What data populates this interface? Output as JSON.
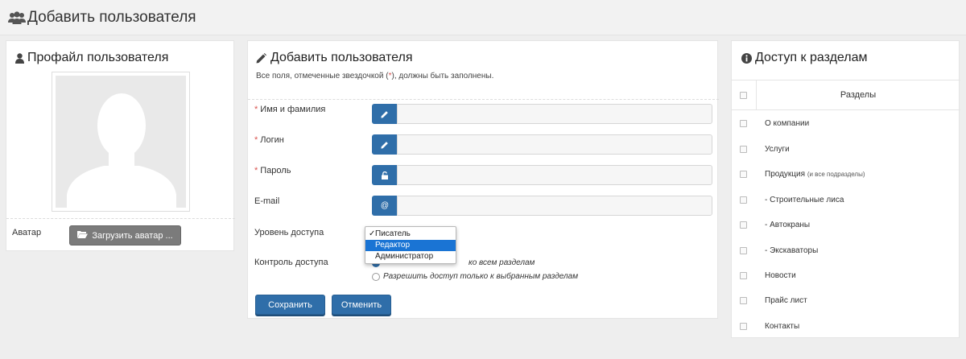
{
  "page": {
    "title": "Добавить пользователя",
    "icon": "users-icon"
  },
  "profile": {
    "title": "Профайл пользователя",
    "icon": "user-icon",
    "avatar_label": "Аватар",
    "upload_button": "Загрузить аватар ...",
    "upload_icon": "folder-open-icon"
  },
  "add_user": {
    "title": "Добавить пользователя",
    "icon": "pencil-icon",
    "note_before": "Все поля, отмеченные звездочкой (",
    "note_star": "*",
    "note_after": "), должны быть заполнены.",
    "fields": [
      {
        "label": "Имя и фамилия",
        "required": true,
        "icon": "pencil-icon",
        "value": ""
      },
      {
        "label": "Логин",
        "required": true,
        "icon": "pencil-icon",
        "value": ""
      },
      {
        "label": "Пароль",
        "required": true,
        "icon": "lock-icon",
        "value": ""
      },
      {
        "label": "E-mail",
        "required": false,
        "icon": "at-icon",
        "value": ""
      }
    ],
    "access_level": {
      "label": "Уровень доступа",
      "options": [
        "Писатель",
        "Редактор",
        "Администратор"
      ],
      "checked": "Писатель",
      "highlighted": "Редактор"
    },
    "access_control": {
      "label": "Контроль доступа",
      "options": [
        {
          "label": "Разрешить доступ ко всем разделам",
          "visible_text": "ко всем разделам",
          "selected": true
        },
        {
          "label": "Разрешить доступ только к выбранным разделам",
          "selected": false
        }
      ]
    },
    "save_button": "Сохранить",
    "cancel_button": "Отменить"
  },
  "access": {
    "title": "Доступ к разделам",
    "icon": "info-circle-icon",
    "column_header": "Разделы",
    "sections": [
      {
        "label": "О компании",
        "suffix": ""
      },
      {
        "label": "Услуги",
        "suffix": ""
      },
      {
        "label": "Продукция",
        "suffix": "(и все подразделы)"
      },
      {
        "label": "- Строительные лиса",
        "suffix": ""
      },
      {
        "label": "- Автокраны",
        "suffix": ""
      },
      {
        "label": "- Экскаваторы",
        "suffix": ""
      },
      {
        "label": "Новости",
        "suffix": ""
      },
      {
        "label": "Прайс лист",
        "suffix": ""
      },
      {
        "label": "Контакты",
        "suffix": ""
      }
    ]
  },
  "colors": {
    "primary": "#2f6ea9",
    "required": "#d9534f",
    "dropdown_highlight": "#1a74d4",
    "upload_button": "#7b7b7b"
  }
}
